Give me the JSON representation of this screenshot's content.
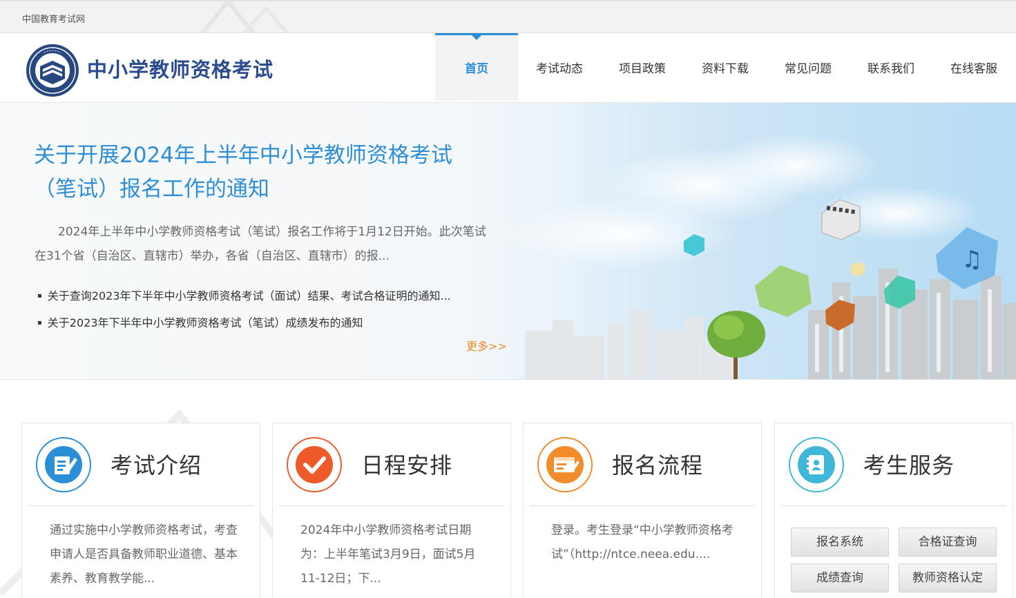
{
  "top_bar": {
    "site_name": "中国教育考试网"
  },
  "header": {
    "logo_icon": "ntce-seal-icon",
    "brand_title": "中小学教师资格考试",
    "nav": [
      {
        "label": "首页",
        "active": true
      },
      {
        "label": "考试动态",
        "active": false
      },
      {
        "label": "项目政策",
        "active": false
      },
      {
        "label": "资料下载",
        "active": false
      },
      {
        "label": "常见问题",
        "active": false
      },
      {
        "label": "联系我们",
        "active": false
      },
      {
        "label": "在线客服",
        "active": false
      }
    ]
  },
  "banner": {
    "headline": "关于开展2024年上半年中小学教师资格考试（笔试）报名工作的通知",
    "summary": "2024年上半年中小学教师资格考试（笔试）报名工作将于1月12日开始。此次笔试在31个省（自治区、直辖市）举办，各省（自治区、直辖市）的报...",
    "news": [
      "关于查询2023年下半年中小学教师资格考试（面试）结果、考试合格证明的通知...",
      "关于2023年下半年中小学教师资格考试（笔试）成绩发布的通知"
    ],
    "more_label": "更多>>"
  },
  "cards": [
    {
      "icon": "exam-document-icon",
      "title": "考试介绍",
      "desc": "通过实施中小学教师资格考试，考查申请人是否具备教师职业道德、基本素养、教育教学能..."
    },
    {
      "icon": "checkmark-icon",
      "title": "日程安排",
      "desc": "2024年中小学教师资格考试日期为：上半年笔试3月9日，面试5月11-12日；下..."
    },
    {
      "icon": "registration-form-icon",
      "title": "报名流程",
      "desc": "登录。考生登录“中小学教师资格考试”（http://ntce.neea.edu...."
    },
    {
      "icon": "candidate-contact-icon",
      "title": "考生服务",
      "buttons": [
        "报名系统",
        "合格证查询",
        "成绩查询",
        "教师资格认定"
      ]
    }
  ],
  "colors": {
    "accent_blue": "#2b8fd8",
    "brand_navy": "#2a4c8f",
    "orange": "#ef5a2b",
    "more_orange": "#ef8a2b",
    "cyan": "#3fb7d8"
  }
}
